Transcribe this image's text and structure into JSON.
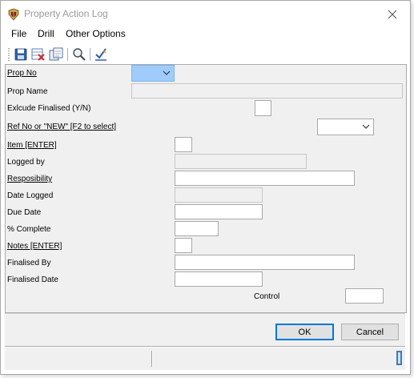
{
  "window": {
    "title": "Property Action Log"
  },
  "menu": {
    "file": "File",
    "drill": "Drill",
    "other_options": "Other Options"
  },
  "form": {
    "prop_no_label": "Prop No",
    "prop_name_label": "Prop Name",
    "exclude_finalised_label": "Exlcude Finalised (Y/N)",
    "ref_no_label": "Ref No or \"NEW\" [F2 to select]",
    "item_label": "Item [ENTER]",
    "logged_by_label": "Logged by",
    "responsibility_label": "Resposibility",
    "date_logged_label": "Date Logged",
    "due_date_label": "Due Date",
    "pct_complete_label": "% Complete",
    "notes_label": "Notes [ENTER]",
    "finalised_by_label": "Finalised By",
    "finalised_date_label": "Finalised Date",
    "control_label": "Control"
  },
  "buttons": {
    "ok": "OK",
    "cancel": "Cancel"
  },
  "colors": {
    "active_combo": "#9fccfb",
    "default_button_border": "#0078d7"
  }
}
